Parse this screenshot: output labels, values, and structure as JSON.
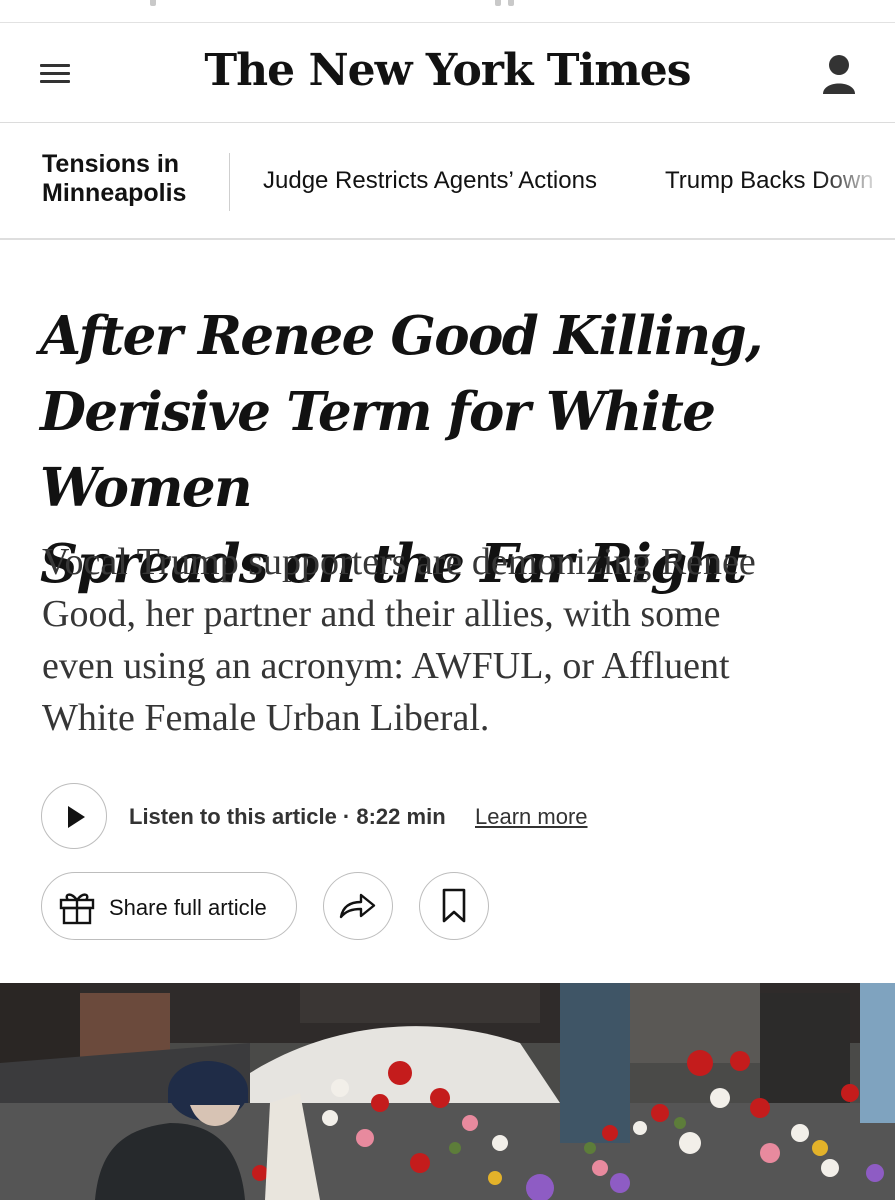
{
  "masthead": {
    "logo": "The New York Times",
    "menu_icon": "hamburger-menu-icon",
    "account_icon": "user-account-icon"
  },
  "subnav": {
    "title_line1": "Tensions in",
    "title_line2": "Minneapolis",
    "links": [
      "Judge Restricts Agents’ Actions",
      "Trump Backs Down"
    ]
  },
  "article": {
    "headline_lines": [
      "After Renee Good Killing,",
      "Derisive Term for White Women",
      "Spreads on the Far Right"
    ],
    "dek_lines": [
      "Vocal Trump supporters are demonizing Renee",
      "Good, her partner and their allies, with some",
      "even using an acronym: AWFUL, or Affluent",
      "White Female Urban Liberal."
    ]
  },
  "audio": {
    "listen_label": "Listen to this article · 8:22 min",
    "learn_more": "Learn more",
    "play_icon": "play-icon"
  },
  "actions": {
    "share_full_label": "Share full article",
    "gift_icon": "gift-icon",
    "share_icon": "share-arrow-icon",
    "bookmark_icon": "bookmark-icon"
  },
  "colors": {
    "text": "#121212",
    "dek": "#363636",
    "border": "#bdbdbd"
  }
}
